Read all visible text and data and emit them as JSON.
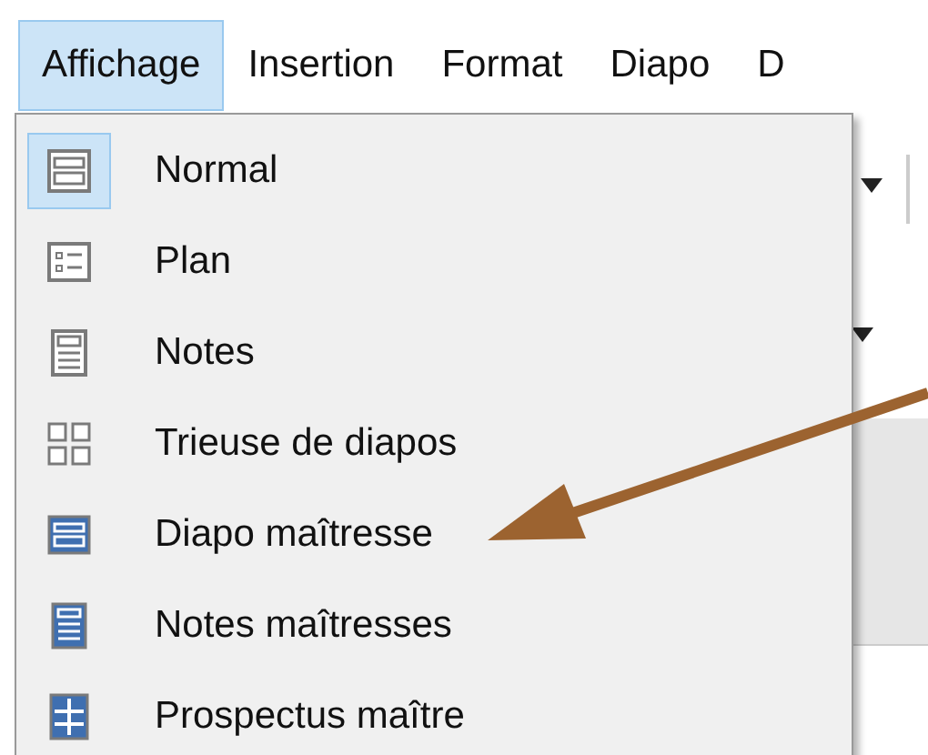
{
  "menubar": [
    {
      "label": "Affichage",
      "selected": true
    },
    {
      "label": "Insertion",
      "selected": false
    },
    {
      "label": "Format",
      "selected": false
    },
    {
      "label": "Diapo",
      "selected": false
    },
    {
      "label": "D",
      "selected": false
    }
  ],
  "menu": {
    "items": [
      {
        "label": "Normal",
        "kind": "normal",
        "checked": true
      },
      {
        "label": "Plan",
        "kind": "outline",
        "checked": false
      },
      {
        "label": "Notes",
        "kind": "notes",
        "checked": false
      },
      {
        "label": "Trieuse de diapos",
        "kind": "sorter",
        "checked": false
      },
      {
        "label": "Diapo maîtresse",
        "kind": "master-slide",
        "checked": false
      },
      {
        "label": "Notes maîtresses",
        "kind": "master-notes",
        "checked": false
      },
      {
        "label": "Prospectus maître",
        "kind": "handout",
        "checked": false
      }
    ]
  }
}
